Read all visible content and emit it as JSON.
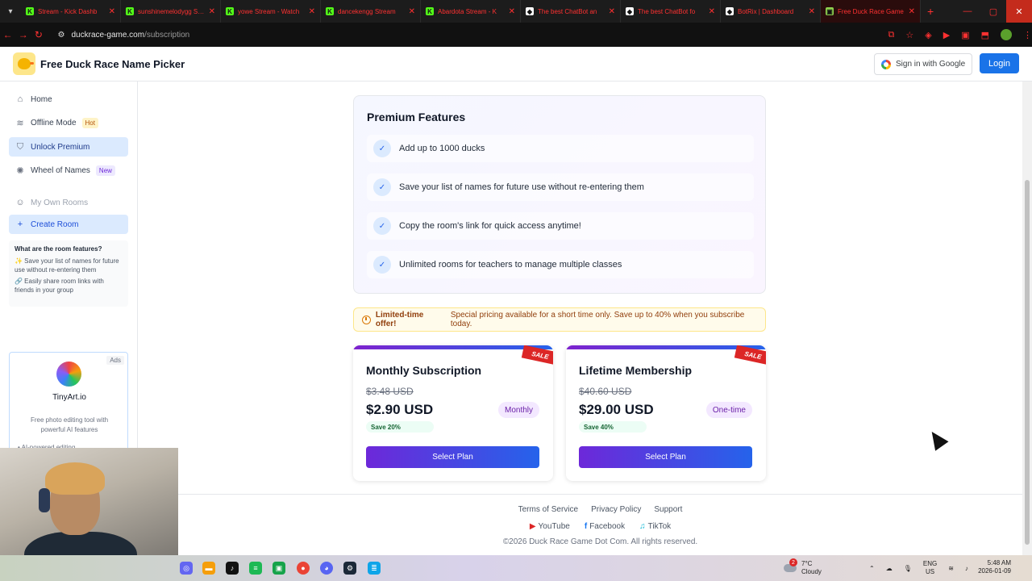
{
  "browser": {
    "tabs": [
      {
        "title": "Stream - Kick Dashb",
        "fav": "K",
        "color": "#53fc18"
      },
      {
        "title": "sunshinemelodygg Stream",
        "fav": "K",
        "color": "#53fc18"
      },
      {
        "title": "yowe Stream - Watch",
        "fav": "K",
        "color": "#53fc18"
      },
      {
        "title": "dancekengg Stream",
        "fav": "K",
        "color": "#53fc18"
      },
      {
        "title": "Abardota Stream - K",
        "fav": "K",
        "color": "#53fc18"
      },
      {
        "title": "The best ChatBot an",
        "fav": "◆",
        "color": "#ffffff"
      },
      {
        "title": "The best ChatBot fo",
        "fav": "◆",
        "color": "#ffffff"
      },
      {
        "title": "BotRix | Dashboard",
        "fav": "◆",
        "color": "#ffffff"
      },
      {
        "title": "Free Duck Race Game",
        "fav": "▣",
        "color": "#8fd14f"
      }
    ],
    "url_domain": "duckrace-game.com",
    "url_path": "/subscription"
  },
  "header": {
    "title": "Free Duck Race Name Picker",
    "google_btn": "Sign in with Google",
    "login_btn": "Login"
  },
  "sidebar": {
    "items": [
      {
        "label": "Home",
        "icon": "home-icon"
      },
      {
        "label": "Offline Mode",
        "icon": "wifi-off-icon",
        "badge": "Hot"
      },
      {
        "label": "Unlock Premium",
        "icon": "shield-icon"
      },
      {
        "label": "Wheel of Names",
        "icon": "wheel-icon",
        "badge": "New"
      }
    ],
    "my_rooms": "My Own Rooms",
    "create_room": "Create Room",
    "features_heading": "What are the room features?",
    "feature_1": "✨ Save your list of names for future use without re-entering them",
    "feature_2": "🔗 Easily share room links with friends in your group",
    "ad": {
      "tag": "Ads",
      "name": "TinyArt.io",
      "desc": "Free photo editing tool with powerful AI features",
      "extra": "• AI-powered editing"
    }
  },
  "premium": {
    "title": "Premium Features",
    "features": [
      "Add up to 1000 ducks",
      "Save your list of names for future use without re-entering them",
      "Copy the room's link for quick access anytime!",
      "Unlimited rooms for teachers to manage multiple classes"
    ]
  },
  "offer": {
    "bold": "Limited-time offer!",
    "text": "Special pricing available for a short time only. Save up to 40% when you subscribe today."
  },
  "plans": [
    {
      "name": "Monthly Subscription",
      "old_price": "$3.48 USD",
      "price": "$2.90 USD",
      "period": "Monthly",
      "save": "Save 20%",
      "sale": "SALE",
      "button": "Select Plan"
    },
    {
      "name": "Lifetime Membership",
      "old_price": "$40.60 USD",
      "price": "$29.00 USD",
      "period": "One-time",
      "save": "Save 40%",
      "sale": "SALE",
      "button": "Select Plan"
    }
  ],
  "footer": {
    "links": [
      "Terms of Service",
      "Privacy Policy",
      "Support"
    ],
    "social": [
      {
        "label": "YouTube",
        "icon": "▶"
      },
      {
        "label": "Facebook",
        "icon": "f"
      },
      {
        "label": "TikTok",
        "icon": "♫"
      }
    ],
    "copyright": "©2026 Duck Race Game Dot Com. All rights reserved."
  },
  "taskbar": {
    "weather_temp": "7°C",
    "weather_text": "Cloudy",
    "weather_badge": "2",
    "lang": "ENG",
    "region": "US",
    "time": "5:48 AM",
    "date": "2026-01-09"
  }
}
